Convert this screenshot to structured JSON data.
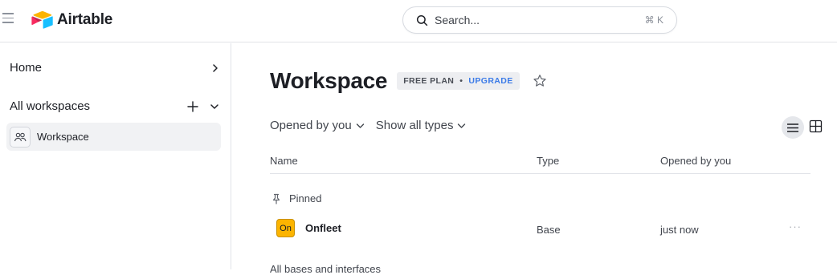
{
  "app": {
    "name": "Airtable"
  },
  "search": {
    "placeholder": "Search...",
    "shortcut": "⌘ K"
  },
  "sidebar": {
    "home_label": "Home",
    "all_workspaces_label": "All workspaces",
    "workspace_item": "Workspace"
  },
  "main": {
    "title": "Workspace",
    "plan": {
      "label": "FREE PLAN",
      "separator": "•",
      "upgrade": "UPGRADE"
    },
    "filters": {
      "opened_by": "Opened by you",
      "types": "Show all types"
    },
    "columns": {
      "name": "Name",
      "type": "Type",
      "opened": "Opened by you"
    },
    "pinned_label": "Pinned",
    "bases": [
      {
        "icon_text": "On",
        "name": "Onfleet",
        "type": "Base",
        "opened": "just now",
        "more": "···",
        "icon_color": "#fcb400"
      }
    ],
    "all_bases_label": "All bases and interfaces"
  },
  "icons": {
    "menu": "hamburger-menu-icon",
    "search": "search-icon",
    "star": "star-icon",
    "list_view": "list-view-icon",
    "grid_view": "grid-view-icon",
    "pin": "pin-icon",
    "workspace": "people-icon"
  },
  "colors": {
    "accent": "#3b7be8",
    "base_icon": "#fcb400"
  }
}
